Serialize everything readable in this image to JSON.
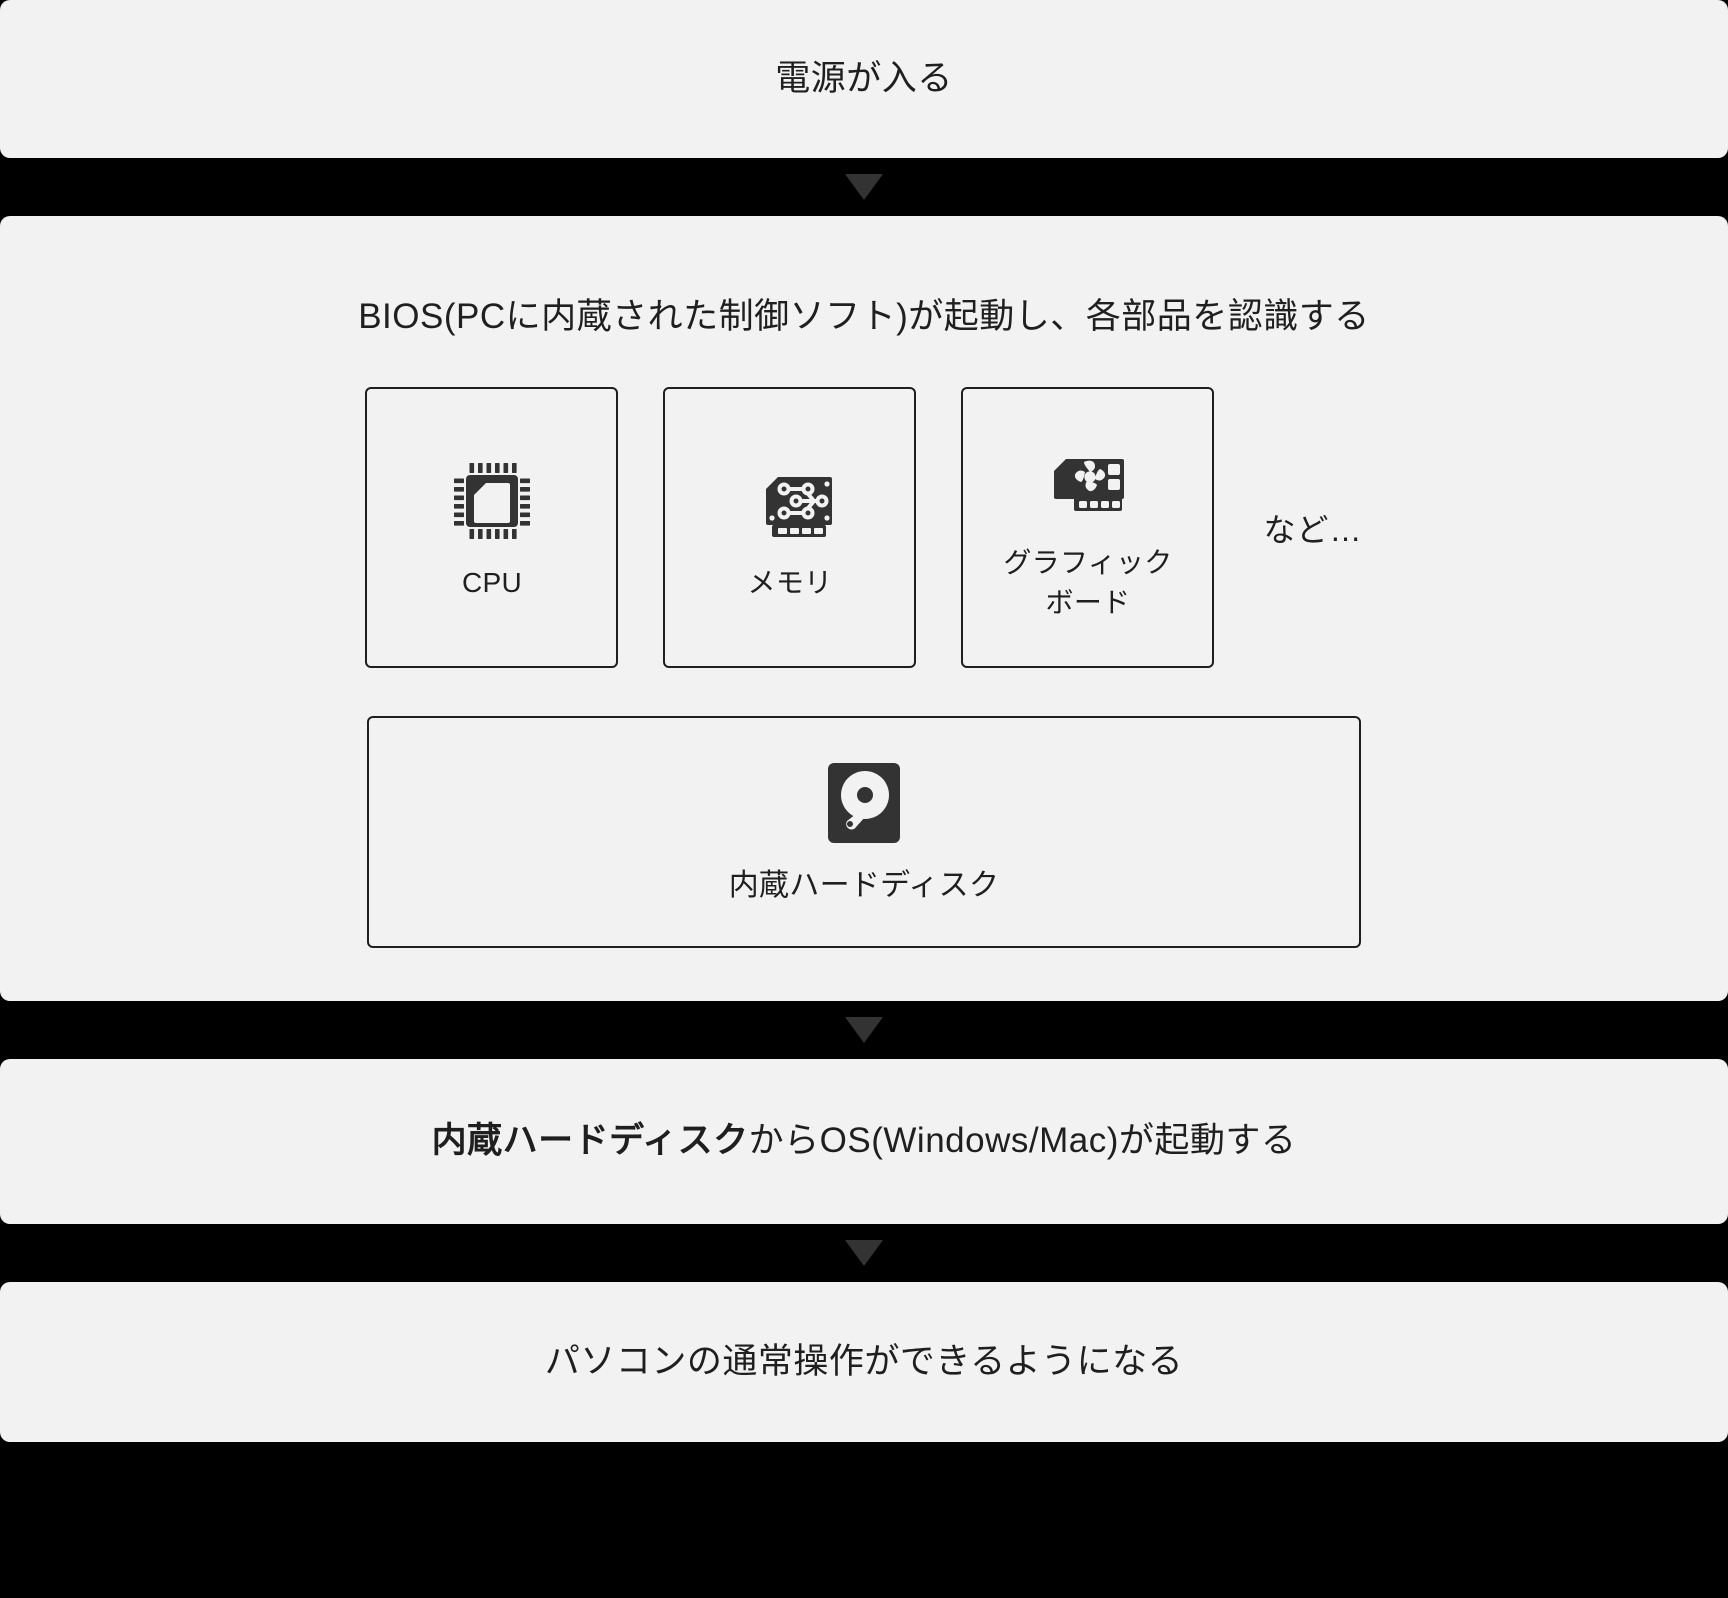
{
  "diagram": {
    "background_color": "#000000",
    "box_color": "#f2f2f2",
    "ink_color": "#1f1f1f",
    "arrow_color": "#333333",
    "steps": {
      "power": {
        "label": "電源が入る"
      },
      "bios": {
        "title": "BIOS(PCに内蔵された制御ソフト)が起動し、各部品を認識する",
        "etc_label": "など…",
        "parts": [
          {
            "label": "CPU",
            "icon": "cpu-chip-icon"
          },
          {
            "label": "メモリ",
            "icon": "memory-module-icon"
          },
          {
            "label": "グラフィック\nボード",
            "icon": "graphics-card-icon"
          }
        ],
        "parts_labels": {
          "cpu": "CPU",
          "memory": "メモリ",
          "graphics_line1": "グラフィック",
          "graphics_line2": "ボード"
        },
        "storage": {
          "label": "内蔵ハードディスク",
          "icon": "hard-disk-icon"
        }
      },
      "os_boot": {
        "label_strong": "内蔵ハードディスク",
        "label_rest": "からOS(Windows/Mac)が起動する"
      },
      "ready": {
        "label": "パソコンの通常操作ができるようになる"
      }
    },
    "arrows": {
      "glyph": "down-triangle",
      "count": 3
    }
  }
}
